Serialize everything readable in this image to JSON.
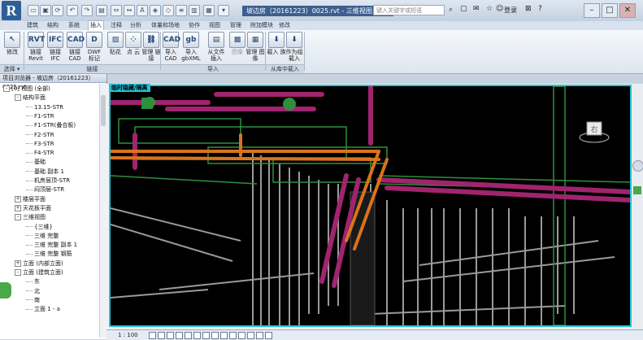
{
  "titlebar": {
    "logo": "R",
    "document_title": "坡边房（20161223）0025.rvt - 三维视图: 三维",
    "search_placeholder": "键入关键字或短语",
    "login_label": "登录"
  },
  "menu_tabs": [
    "建筑",
    "结构",
    "系统",
    "插入",
    "注释",
    "分析",
    "体量和场地",
    "协作",
    "视图",
    "管理",
    "附加模块",
    "修改"
  ],
  "ribbon": {
    "modify": {
      "label": "修改",
      "icon": "cursor-icon"
    },
    "link_revit": {
      "label": "链接 Revit"
    },
    "link_ifc": {
      "label": "链接 IFC"
    },
    "link_cad": {
      "label": "链接 CAD"
    },
    "dwf_markup": {
      "label": "DWF 标记"
    },
    "decal": {
      "label": "贴花"
    },
    "point_cloud": {
      "label": "点 云"
    },
    "manage_links": {
      "label": "管理 链接"
    },
    "import_cad": {
      "label": "导入 CAD"
    },
    "import_gbxml": {
      "label": "导入 gbXML"
    },
    "insert_from_file": {
      "label": "从文件 插入"
    },
    "image": {
      "label": "图像"
    },
    "manage_images": {
      "label": "管理 图像"
    },
    "load_family": {
      "label": "载入 族"
    },
    "load_as_group": {
      "label": "作为组 载入"
    },
    "panels": {
      "select": "选择",
      "link": "链接",
      "import": "导入",
      "load_from_library": "从库中载入"
    }
  },
  "browser": {
    "title": "项目浏览器 - 坡边房（20161223）0025.rvt",
    "items": [
      {
        "label": "[0] 视图 (全部)",
        "indent": 1,
        "toggle": "-"
      },
      {
        "label": "结构平面",
        "indent": 2,
        "toggle": "-"
      },
      {
        "label": "13.15-STR",
        "indent": 3,
        "toggle": ""
      },
      {
        "label": "F1-STR",
        "indent": 3,
        "toggle": ""
      },
      {
        "label": "F1-STR(叠合板)",
        "indent": 3,
        "toggle": ""
      },
      {
        "label": "F2-STR",
        "indent": 3,
        "toggle": ""
      },
      {
        "label": "F3-STR",
        "indent": 3,
        "toggle": ""
      },
      {
        "label": "F4-STR",
        "indent": 3,
        "toggle": ""
      },
      {
        "label": "基础",
        "indent": 3,
        "toggle": ""
      },
      {
        "label": "基础 副本 1",
        "indent": 3,
        "toggle": ""
      },
      {
        "label": "机房层顶-STR",
        "indent": 3,
        "toggle": ""
      },
      {
        "label": "闷顶层-STR",
        "indent": 3,
        "toggle": ""
      },
      {
        "label": "楼层平面",
        "indent": 2,
        "toggle": "+"
      },
      {
        "label": "天花板平面",
        "indent": 2,
        "toggle": "+"
      },
      {
        "label": "三维视图",
        "indent": 2,
        "toggle": "-"
      },
      {
        "label": "{三维}",
        "indent": 3,
        "toggle": ""
      },
      {
        "label": "三维 完整",
        "indent": 3,
        "toggle": ""
      },
      {
        "label": "三维 完整 副本 1",
        "indent": 3,
        "toggle": ""
      },
      {
        "label": "三维 完整 钢筋",
        "indent": 3,
        "toggle": ""
      },
      {
        "label": "立面 (内部立面)",
        "indent": 2,
        "toggle": "+"
      },
      {
        "label": "立面 (建筑立面)",
        "indent": 2,
        "toggle": "-"
      },
      {
        "label": "东",
        "indent": 3,
        "toggle": ""
      },
      {
        "label": "北",
        "indent": 3,
        "toggle": ""
      },
      {
        "label": "南",
        "indent": 3,
        "toggle": ""
      },
      {
        "label": "立面 1 - a",
        "indent": 3,
        "toggle": ""
      }
    ]
  },
  "view": {
    "temp_label": "临时隐藏/隔离",
    "viewcube_face": "右"
  },
  "statusbar": {
    "scale": "1 : 100"
  },
  "colors": {
    "accent": "#25c2d6",
    "pipe_magenta": "#a0246e",
    "pipe_orange": "#d9731c",
    "pipe_green": "#2f8f3d",
    "pipe_gray": "#bdbdbd"
  }
}
